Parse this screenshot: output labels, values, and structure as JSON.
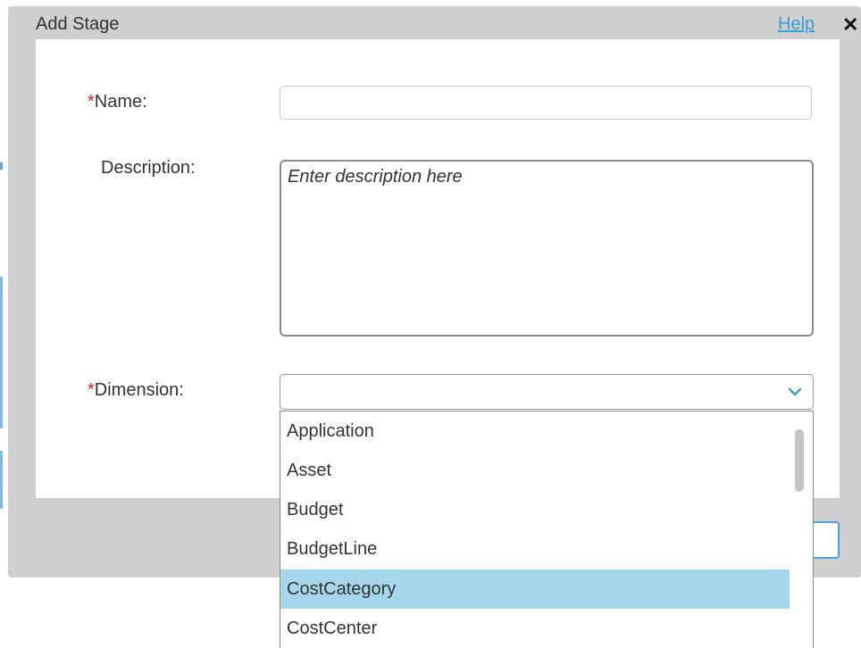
{
  "dialog": {
    "title": "Add Stage",
    "help_label": "Help",
    "close_icon": "close-icon"
  },
  "form": {
    "name_label": "Name:",
    "name_value": "",
    "description_label": "Description:",
    "description_placeholder": "Enter description here",
    "dimension_label": "Dimension:",
    "dimension_value": "",
    "required_marker": "*"
  },
  "dropdown": {
    "options": [
      "Application",
      "Asset",
      "Budget",
      "BudgetLine",
      "CostCategory",
      "CostCenter"
    ],
    "highlighted": "CostCategory"
  },
  "colors": {
    "required": "#d42020",
    "link": "#3a9bd5",
    "highlight": "#a6d6ec",
    "chevron": "#3a9bd5"
  }
}
